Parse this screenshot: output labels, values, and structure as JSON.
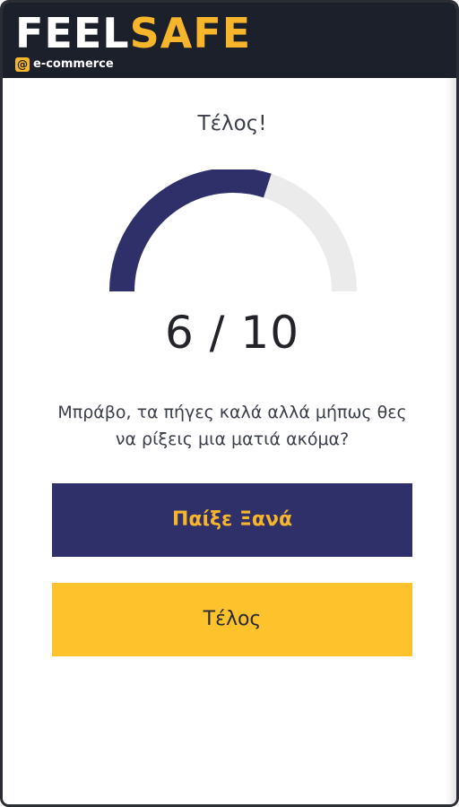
{
  "header": {
    "logo_part1": "FEEL",
    "logo_part2": "SAFE",
    "logo_badge": "@",
    "logo_sub": "e-commerce"
  },
  "main": {
    "title": "Τέλος!",
    "score_text": "6 / 10",
    "score_value": 6,
    "score_max": 10,
    "message": "Μπράβο, τα πήγες καλά αλλά μήπως θες να ρίξεις μια ματιά ακόμα?",
    "replay_label": "Παίξε Ξανά",
    "end_label": "Τέλος"
  },
  "colors": {
    "header_bg": "#1b202a",
    "accent_yellow": "#fec22c",
    "brand_navy": "#2f2f6a",
    "gauge_track": "#ebebeb",
    "gauge_fill": "#2f2f6a"
  }
}
